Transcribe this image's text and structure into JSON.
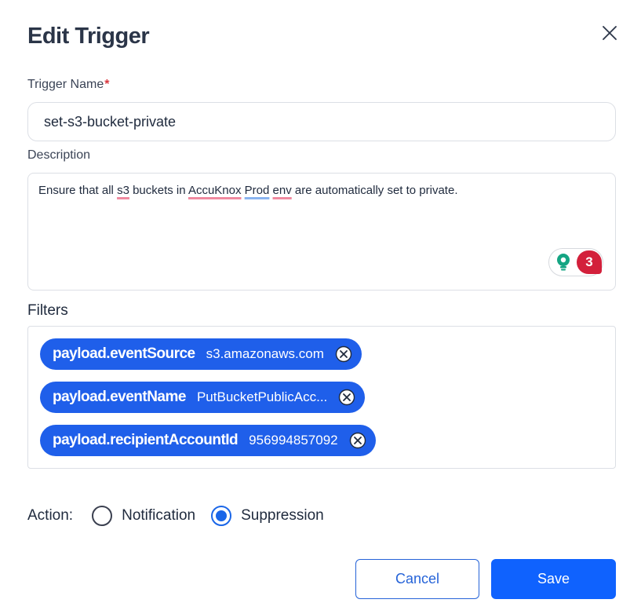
{
  "dialog": {
    "title": "Edit Trigger"
  },
  "trigger_name": {
    "label": "Trigger Name",
    "required_marker": "*",
    "value": "set-s3-bucket-private"
  },
  "description": {
    "label": "Description",
    "text_parts": {
      "p1": "Ensure that all ",
      "w1": "s3",
      "p2": " buckets in ",
      "w2": "AccuKnox",
      "p3": " ",
      "w3": "Prod env",
      "p4": " are automatically set to private."
    },
    "grammar_count": "3"
  },
  "filters": {
    "label": "Filters",
    "items": [
      {
        "key": "payload.eventSource",
        "value": "s3.amazonaws.com"
      },
      {
        "key": "payload.eventName",
        "value": "PutBucketPublicAcc..."
      },
      {
        "key": "payload.recipientAccountId",
        "value": "956994857092"
      }
    ]
  },
  "action": {
    "label": "Action:",
    "options": [
      {
        "label": "Notification",
        "selected": false
      },
      {
        "label": "Suppression",
        "selected": true
      }
    ]
  },
  "buttons": {
    "cancel": "Cancel",
    "save": "Save"
  },
  "colors": {
    "primary": "#0f62fe",
    "chip": "#1f5fea",
    "required": "#d9363e",
    "grammar_badge": "#d3203b"
  }
}
